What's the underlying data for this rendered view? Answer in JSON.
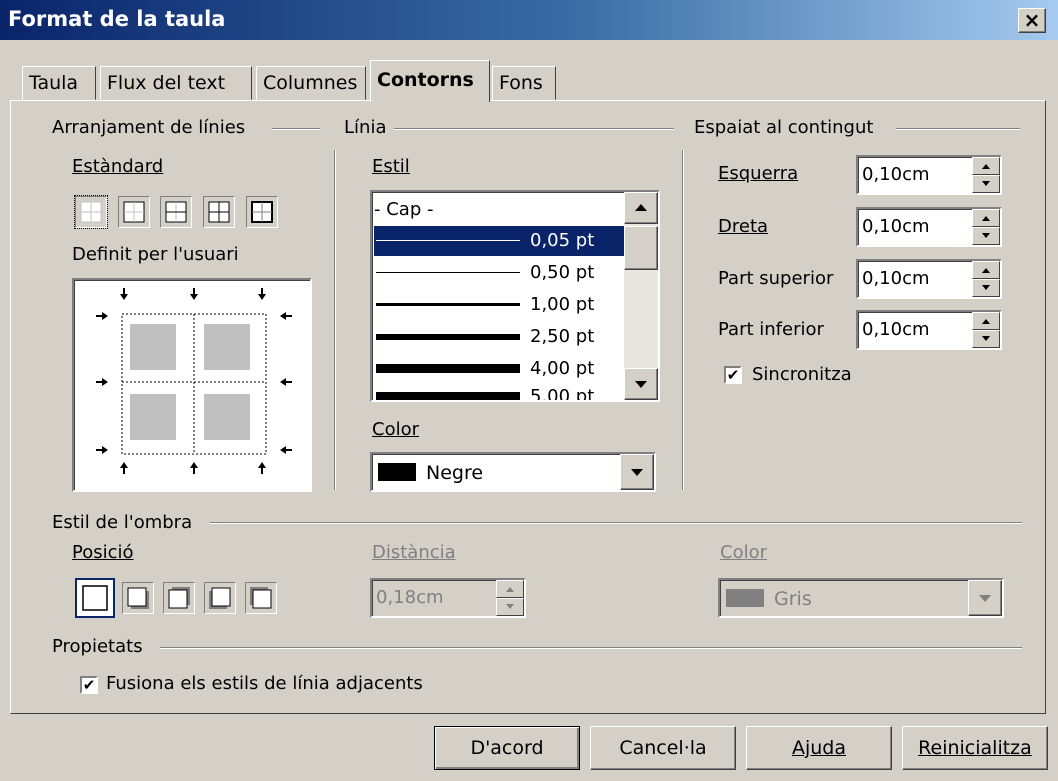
{
  "window": {
    "title": "Format de la taula",
    "close_label": "×"
  },
  "tabs": [
    {
      "label": "Taula"
    },
    {
      "label": "Flux del text"
    },
    {
      "label": "Columnes"
    },
    {
      "label": "Contorns",
      "active": true
    },
    {
      "label": "Fons"
    }
  ],
  "line_arrangement": {
    "title": "Arranjament de línies",
    "default_label": "Estàndard",
    "user_defined_label": "Definit per l'usuari"
  },
  "line": {
    "title": "Línia",
    "style_label": "Estil",
    "styles": [
      {
        "label": "- Cap -"
      },
      {
        "label": "0,05 pt",
        "selected": true
      },
      {
        "label": "0,50 pt"
      },
      {
        "label": "1,00 pt"
      },
      {
        "label": "2,50 pt"
      },
      {
        "label": "4,00 pt"
      },
      {
        "label": "5,00 pt"
      }
    ],
    "color_label": "Color",
    "color_value": "Negre",
    "color_swatch": "#000000"
  },
  "spacing": {
    "title": "Espaiat al contingut",
    "left_label": "Esquerra",
    "left_value": "0,10cm",
    "right_label": "Dreta",
    "right_value": "0,10cm",
    "top_label": "Part superior",
    "top_value": "0,10cm",
    "bottom_label": "Part inferior",
    "bottom_value": "0,10cm",
    "sync_label": "Sincronitza",
    "sync_checked": true
  },
  "shadow": {
    "title": "Estil de l'ombra",
    "position_label": "Posició",
    "distance_label": "Distància",
    "distance_value": "0,18cm",
    "color_label": "Color",
    "color_value": "Gris",
    "color_swatch": "#808080"
  },
  "properties": {
    "title": "Propietats",
    "merge_label": "Fusiona els estils de línia adjacents",
    "merge_checked": true
  },
  "buttons": {
    "ok": "D'acord",
    "cancel": "Cancel·la",
    "help": "Ajuda",
    "reset": "Reinicialitza"
  }
}
